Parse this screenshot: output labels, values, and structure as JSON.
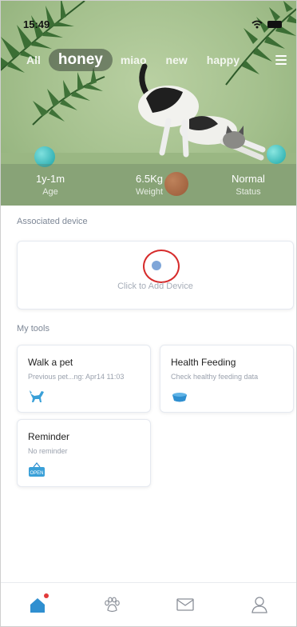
{
  "status_bar": {
    "time": "15:49"
  },
  "pet_tabs": [
    "All",
    "honey",
    "miao",
    "new",
    "happy"
  ],
  "active_tab_index": 1,
  "stats": [
    {
      "value": "1y-1m",
      "label": "Age"
    },
    {
      "value": "6.5Kg",
      "label": "Weight"
    },
    {
      "value": "Normal",
      "label": "Status"
    }
  ],
  "associated_device": {
    "title": "Associated device",
    "add_label": "Click to Add Device"
  },
  "tools": {
    "title": "My tools",
    "items": [
      {
        "title": "Walk a pet",
        "subtitle": "Previous pet...ng: Apr14 11:03",
        "icon": "dog-icon"
      },
      {
        "title": "Health Feeding",
        "subtitle": "Check healthy feeding data",
        "icon": "food-bowl-icon"
      },
      {
        "title": "Reminder",
        "subtitle": "No reminder",
        "icon": "open-sign-icon",
        "icon_text": "OPEN"
      }
    ]
  },
  "bottom_nav": [
    "home-icon",
    "paw-icon",
    "mail-icon",
    "user-icon"
  ],
  "colors": {
    "accent": "#2f8fd0",
    "highlight_ring": "#d62b2b",
    "notification_dot": "#e23a3a"
  }
}
